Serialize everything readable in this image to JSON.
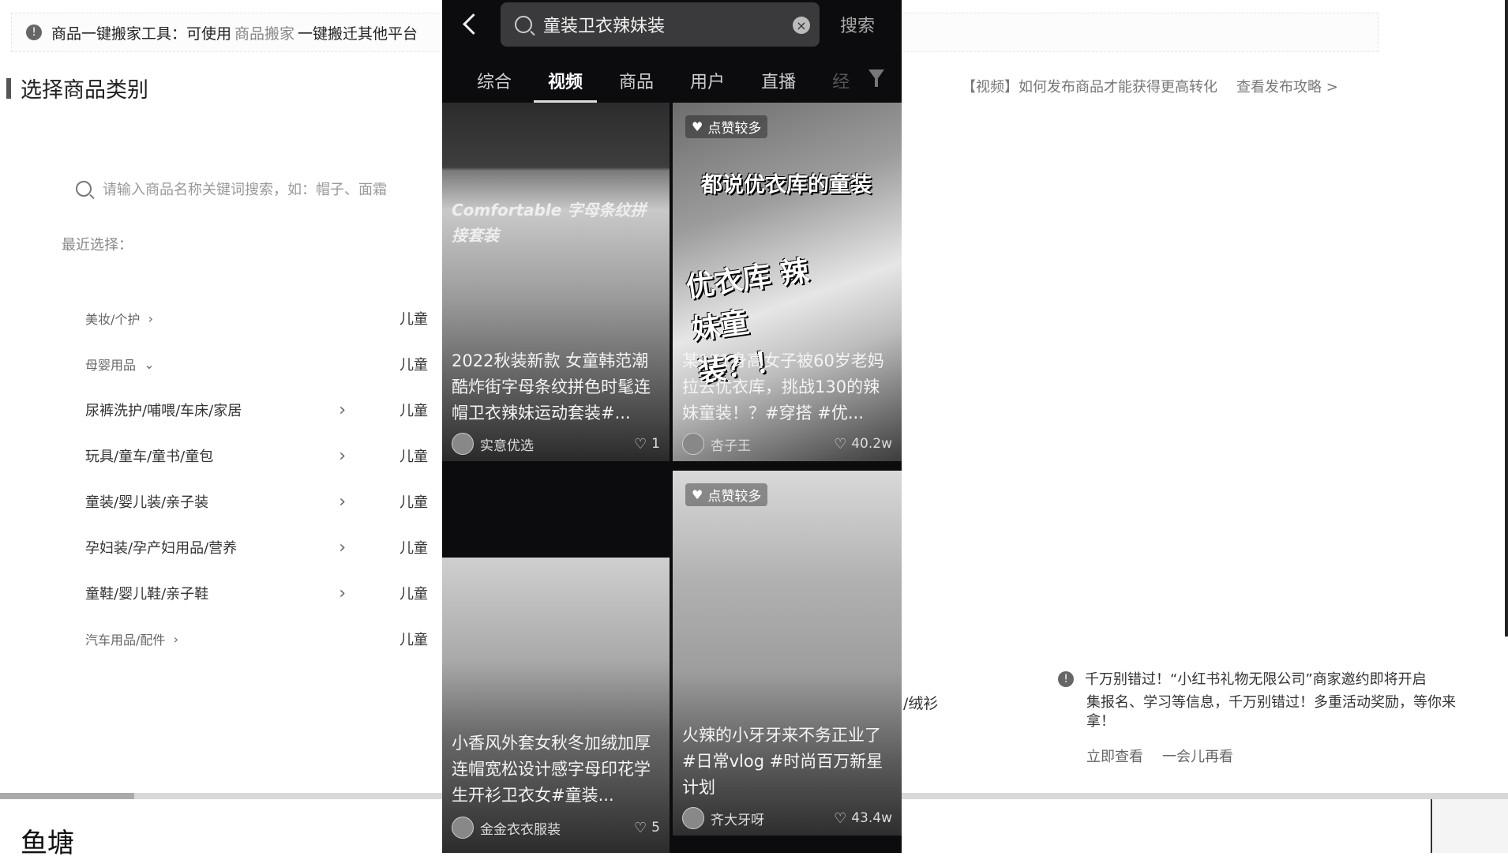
{
  "notice": {
    "prefix": "商品一键搬家工具：可使用",
    "link": "商品搬家",
    "suffix": "一键搬迁其他平台"
  },
  "section": {
    "title": "选择商品类别"
  },
  "search": {
    "placeholder": "请输入商品名称关键词搜索，如：帽子、面霜"
  },
  "recent_label": "最近选择：",
  "categories": [
    {
      "label": "美妆/个护",
      "chevron": "›"
    },
    {
      "label": "母婴用品",
      "chevron": "⌄"
    },
    {
      "label": "尿裤洗护/哺喂/车床/家居",
      "chevron": "›"
    },
    {
      "label": "玩具/童车/童书/童包",
      "chevron": "›"
    },
    {
      "label": "童装/婴儿装/亲子装",
      "chevron": "›"
    },
    {
      "label": "孕妇装/孕产妇用品/营养",
      "chevron": "›"
    },
    {
      "label": "童鞋/婴儿鞋/亲子鞋",
      "chevron": "›"
    },
    {
      "label": "汽车用品/配件",
      "chevron": "›"
    }
  ],
  "subcategories": [
    "儿童",
    "儿童",
    "儿童",
    "儿童",
    "儿童",
    "儿童",
    "儿童",
    "儿童"
  ],
  "stray_text": "/绒衫",
  "guide": {
    "video_link": "【视频】如何发布商品才能获得更高转化",
    "strategy_link": "查看发布攻略 >"
  },
  "banner": {
    "title": "千万别错过！“小红书礼物无限公司”商家邀约即将开启",
    "body": "集报名、学习等信息，千万别错过！多重活动奖励，等你来拿！",
    "action_view": "立即查看",
    "action_later": "一会儿再看"
  },
  "pond_title": "鱼塘",
  "phone": {
    "query": "童装卫衣辣妹装",
    "search_button": "搜索",
    "tabs": [
      "综合",
      "视频",
      "商品",
      "用户",
      "直播",
      "经"
    ],
    "active_tab": "视频",
    "badge_text": "点赞较多",
    "cards": [
      {
        "overlay": "Comfortable 字母条纹拼接套装",
        "caption": "2022秋装新款 女童韩范潮酷炸街字母条纹拼色时髦连帽卫衣辣妹运动套装#...",
        "author": "实意优选",
        "likes": "1"
      },
      {
        "headline": "都说优衣库的童装",
        "headline2": "优衣库 辣妹童装？！",
        "caption": "某171身高女子被60岁老妈拉去优衣库，挑战130的辣妹童装！？#穿搭 #优...",
        "author": "杏子王",
        "likes": "40.2w"
      },
      {
        "caption": "小香风外套女秋冬加绒加厚连帽宽松设计感字母印花学生开衫卫衣女#童装...",
        "author": "金金衣衣服装",
        "likes": "5"
      },
      {
        "caption": "火辣的小牙牙来不务正业了#日常vlog #时尚百万新星计划",
        "author": "齐大牙呀",
        "likes": "43.4w"
      }
    ]
  }
}
